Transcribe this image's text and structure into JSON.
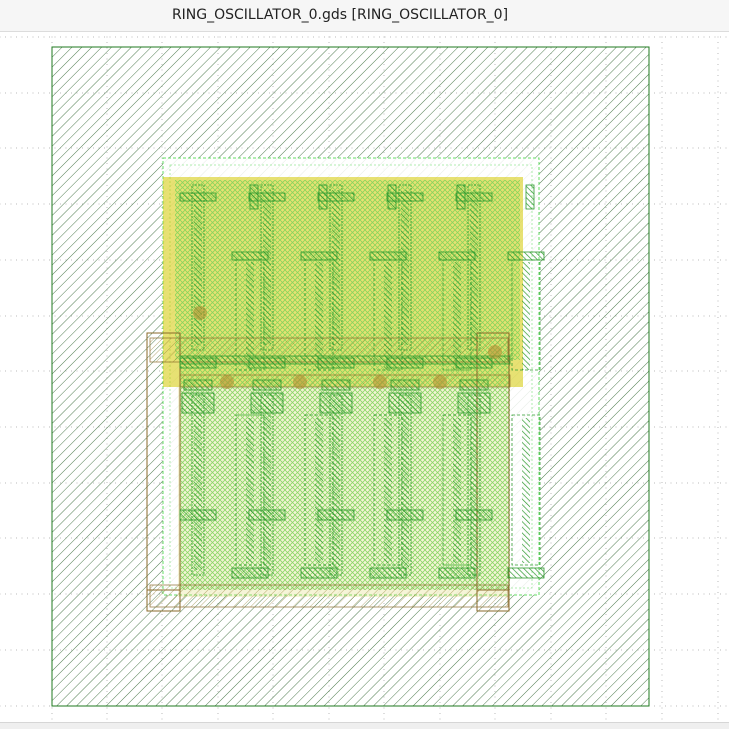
{
  "window": {
    "title": "RING_OSCILLATOR_0.gds [RING_OSCILLATOR_0]"
  },
  "layout_view": {
    "cell_name": "RING_OSCILLATOR_0",
    "file_name": "RING_OSCILLATOR_0.gds",
    "colors": {
      "canvas_background": "#ffffff",
      "grid_dots": "#9a9a9a",
      "boundary_outline": "#1f7a1f",
      "boundary_hatch": "#3d6e3d",
      "nwell_fill": "#d4c900",
      "active_hatch": "#7fd45a",
      "poly": "#2f9a2f",
      "metal_outline": "#8a6a2a",
      "implant_outline": "#66dd66"
    },
    "layers": [
      {
        "name": "boundary",
        "pattern": "diagonal-hatch"
      },
      {
        "name": "nwell",
        "pattern": "solid-translucent"
      },
      {
        "name": "implant",
        "pattern": "dashed-outline"
      },
      {
        "name": "active",
        "pattern": "cross-hatch"
      },
      {
        "name": "poly",
        "pattern": "dense-hatch"
      },
      {
        "name": "metal1",
        "pattern": "outline"
      }
    ],
    "stages": 5
  }
}
